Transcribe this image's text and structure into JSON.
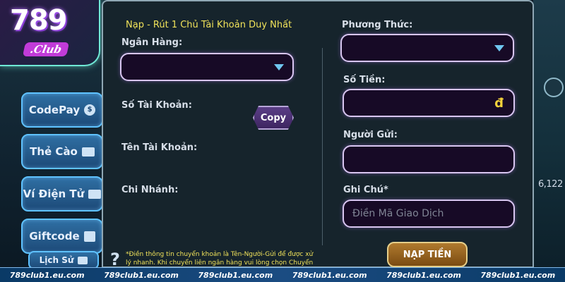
{
  "logo": {
    "number": "789",
    "club": ".Club"
  },
  "sidebar": {
    "items": [
      {
        "label": "CodePay",
        "icon": "coin-icon"
      },
      {
        "label": "Thẻ Cào",
        "icon": "card-icon"
      },
      {
        "label": "Ví Điện Tử",
        "icon": "wallet-icon"
      },
      {
        "label": "Giftcode",
        "icon": "gift-icon"
      }
    ],
    "history_label": "Lịch Sử"
  },
  "form": {
    "notice": "Nạp - Rút 1 Chủ Tài Khoản Duy Nhất",
    "bank_label": "Ngân Hàng:",
    "account_number_label": "Số Tài Khoản:",
    "copy_label": "Copy",
    "account_name_label": "Tên Tài Khoản:",
    "branch_label": "Chi Nhánh:",
    "method_label": "Phương Thức:",
    "amount_label": "Số Tiền:",
    "currency_symbol": "đ",
    "sender_label": "Người Gửi:",
    "note_label": "Ghi Chú*",
    "note_placeholder": "Điền Mã Giao Dịch",
    "submit_label": "NẠP TIỀN",
    "help_symbol": "?",
    "footnote": "*Điền thông tin chuyển khoản là Tên-Người-Gửi để được xử lý nhanh. Khi chuyển liên ngân hàng vui lòng chọn Chuyển"
  },
  "background": {
    "right_text": "6,122"
  },
  "footer": {
    "items": [
      "789club1.eu.com",
      "789club1.eu.com",
      "789club1.eu.com",
      "789club1.eu.com",
      "789club1.eu.com",
      "789club1.eu.com"
    ]
  },
  "colors": {
    "notice": "#f0e25a",
    "field_border": "#d8c6f0",
    "accent": "#5fc2ff",
    "submit": "#b07a2e"
  }
}
